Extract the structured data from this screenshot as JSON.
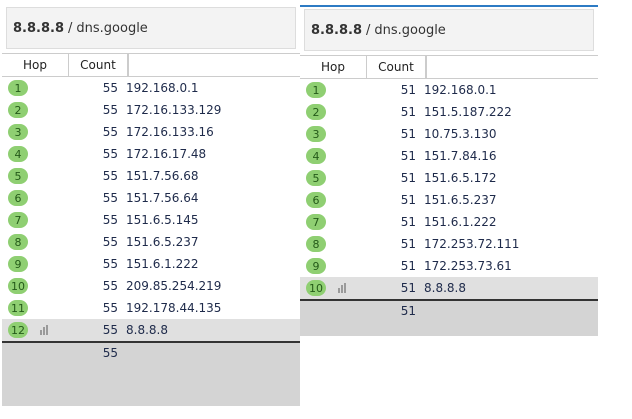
{
  "panels": [
    {
      "title_host": "8.8.8.8",
      "title_sep": "/",
      "title_name": "dns.google",
      "columns": [
        "Hop",
        "Count",
        ""
      ],
      "rows": [
        {
          "hop": "1",
          "count": "55",
          "address": "192.168.0.1"
        },
        {
          "hop": "2",
          "count": "55",
          "address": "172.16.133.129"
        },
        {
          "hop": "3",
          "count": "55",
          "address": "172.16.133.16"
        },
        {
          "hop": "4",
          "count": "55",
          "address": "172.16.17.48"
        },
        {
          "hop": "5",
          "count": "55",
          "address": "151.7.56.68"
        },
        {
          "hop": "6",
          "count": "55",
          "address": "151.7.56.64"
        },
        {
          "hop": "7",
          "count": "55",
          "address": "151.6.5.145"
        },
        {
          "hop": "8",
          "count": "55",
          "address": "151.6.5.237"
        },
        {
          "hop": "9",
          "count": "55",
          "address": "151.6.1.222"
        },
        {
          "hop": "10",
          "count": "55",
          "address": "209.85.254.219"
        },
        {
          "hop": "11",
          "count": "55",
          "address": "192.178.44.135"
        },
        {
          "hop": "12",
          "count": "55",
          "address": "8.8.8.8",
          "selected": true
        }
      ],
      "summary_count": "55"
    },
    {
      "title_host": "8.8.8.8",
      "title_sep": "/",
      "title_name": "dns.google",
      "columns": [
        "Hop",
        "Count",
        ""
      ],
      "rows": [
        {
          "hop": "1",
          "count": "51",
          "address": "192.168.0.1"
        },
        {
          "hop": "2",
          "count": "51",
          "address": "151.5.187.222"
        },
        {
          "hop": "3",
          "count": "51",
          "address": "10.75.3.130"
        },
        {
          "hop": "4",
          "count": "51",
          "address": "151.7.84.16"
        },
        {
          "hop": "5",
          "count": "51",
          "address": "151.6.5.172"
        },
        {
          "hop": "6",
          "count": "51",
          "address": "151.6.5.237"
        },
        {
          "hop": "7",
          "count": "51",
          "address": "151.6.1.222"
        },
        {
          "hop": "8",
          "count": "51",
          "address": "172.253.72.111"
        },
        {
          "hop": "9",
          "count": "51",
          "address": "172.253.73.61"
        },
        {
          "hop": "10",
          "count": "51",
          "address": "8.8.8.8",
          "selected": true
        }
      ],
      "summary_count": "51"
    }
  ]
}
